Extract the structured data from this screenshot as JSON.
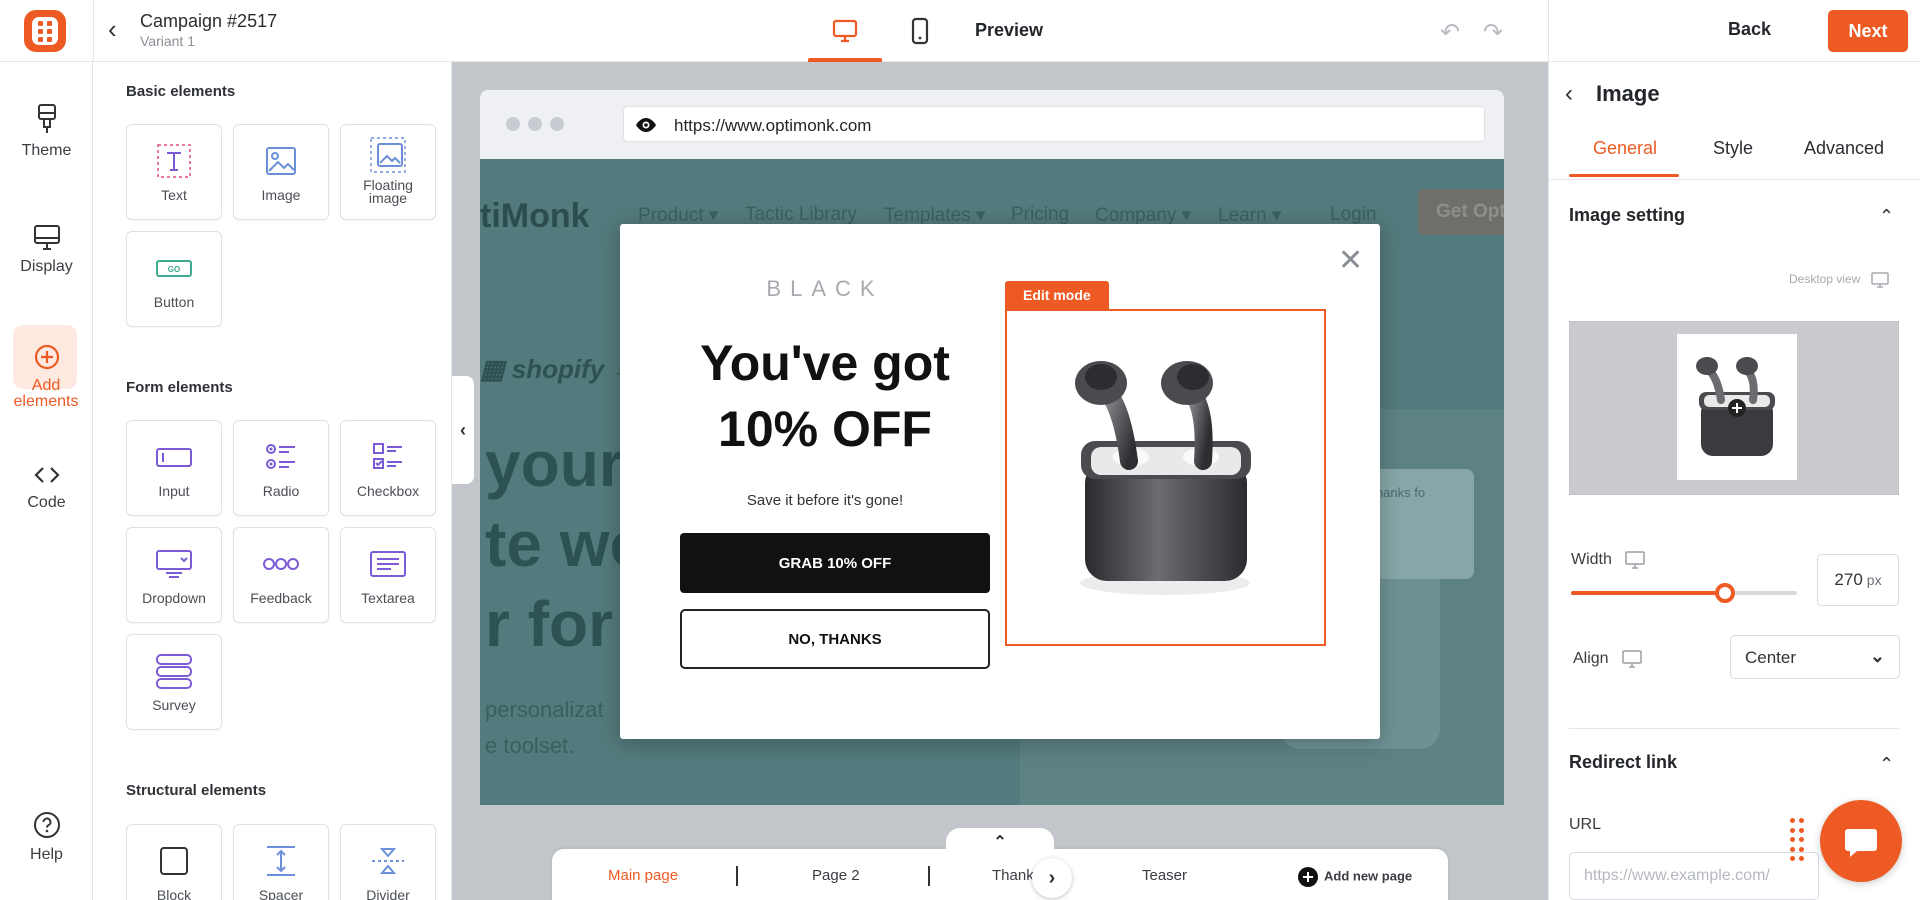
{
  "topbar": {
    "campaign_title": "Campaign #2517",
    "campaign_variant": "Variant 1",
    "preview_label": "Preview",
    "back_label": "Back",
    "next_label": "Next"
  },
  "leftnav": {
    "items": [
      {
        "label": "Theme",
        "icon": "brush-icon"
      },
      {
        "label": "Display",
        "icon": "monitor-icon"
      },
      {
        "label": "Add elements",
        "icon": "plus-circle-icon",
        "active": true
      },
      {
        "label": "Code",
        "icon": "code-icon"
      },
      {
        "label": "Help",
        "icon": "help-icon"
      }
    ]
  },
  "elements_panel": {
    "basic_title": "Basic elements",
    "basic": [
      "Text",
      "Image",
      "Floating image",
      "Button"
    ],
    "form_title": "Form elements",
    "form": [
      "Input",
      "Radio",
      "Checkbox",
      "Dropdown",
      "Feedback",
      "Textarea",
      "Survey"
    ],
    "structural_title": "Structural elements",
    "structural": [
      "Block",
      "Spacer",
      "Divider"
    ]
  },
  "browser": {
    "url": "https://www.optimonk.com"
  },
  "site": {
    "logo": "tiMonk",
    "menu": [
      "Product ▾",
      "Tactic Library",
      "Templates ▾",
      "Pricing",
      "Company ▾",
      "Learn ▾",
      "Login"
    ],
    "cta": "Get Opti",
    "shopify": "shopify",
    "hero_lines": [
      "your",
      "te wo",
      "r for y"
    ],
    "hero_sub_lines": [
      "personalizat",
      "e toolset."
    ],
    "card_text": "Thanks fo"
  },
  "popup": {
    "brand": "BLACK",
    "headline_line1": "You've got",
    "headline_line2": "10% OFF",
    "subtext": "Save it before it's gone!",
    "primary_cta": "GRAB 10% OFF",
    "secondary_cta": "NO, THANKS",
    "edit_mode_tag": "Edit mode"
  },
  "pages": {
    "tabs": [
      "Main page",
      "Page 2",
      "Thank",
      "Teaser"
    ],
    "active_tab": "Main page",
    "add_label": "Add new page"
  },
  "right_panel": {
    "title": "Image",
    "tabs": [
      "General",
      "Style",
      "Advanced"
    ],
    "active_tab": "General",
    "image_setting_title": "Image setting",
    "desktop_view_label": "Desktop view",
    "width_label": "Width",
    "width_value": "270",
    "width_unit": "px",
    "width_slider_fraction": 0.68,
    "align_label": "Align",
    "align_value": "Center",
    "redirect_title": "Redirect link",
    "url_label": "URL",
    "url_placeholder": "https://www.example.com/"
  },
  "colors": {
    "accent": "#ee5a24",
    "site_overlay": "#537a7c"
  }
}
